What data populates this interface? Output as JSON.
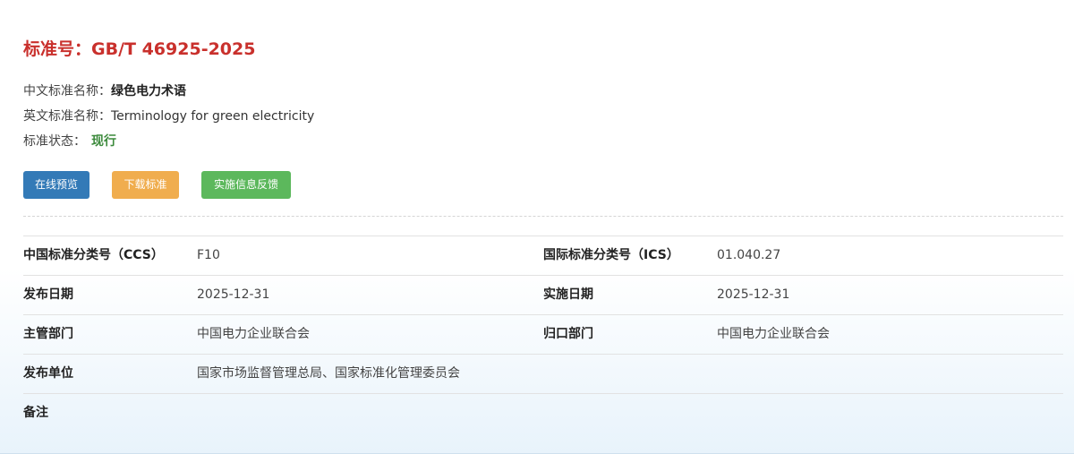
{
  "title": "标准号：GB/T 46925-2025",
  "info": {
    "cn_name_label": "中文标准名称：",
    "cn_name_value": "绿色电力术语",
    "en_name_label": "英文标准名称：",
    "en_name_value": "Terminology for green electricity",
    "status_label": "标准状态：",
    "status_value": "现行"
  },
  "buttons": {
    "preview": "在线预览",
    "download": "下载标准",
    "feedback": "实施信息反馈"
  },
  "table": {
    "ccs_label": "中国标准分类号（CCS）",
    "ccs_value": "F10",
    "ics_label": "国际标准分类号（ICS）",
    "ics_value": "01.040.27",
    "publish_date_label": "发布日期",
    "publish_date_value": "2025-12-31",
    "impl_date_label": "实施日期",
    "impl_date_value": "2025-12-31",
    "dept_label": "主管部门",
    "dept_value": "中国电力企业联合会",
    "gk_label": "归口部门",
    "gk_value": "中国电力企业联合会",
    "issuer_label": "发布单位",
    "issuer_value": "国家市场监督管理总局、国家标准化管理委员会",
    "remark_label": "备注",
    "remark_value": ""
  },
  "colors": {
    "title": "#c9302c",
    "status": "#3c8a3c",
    "preview_button": "#337ab7",
    "download_button": "#f0ad4e",
    "feedback_button": "#5cb85c"
  }
}
